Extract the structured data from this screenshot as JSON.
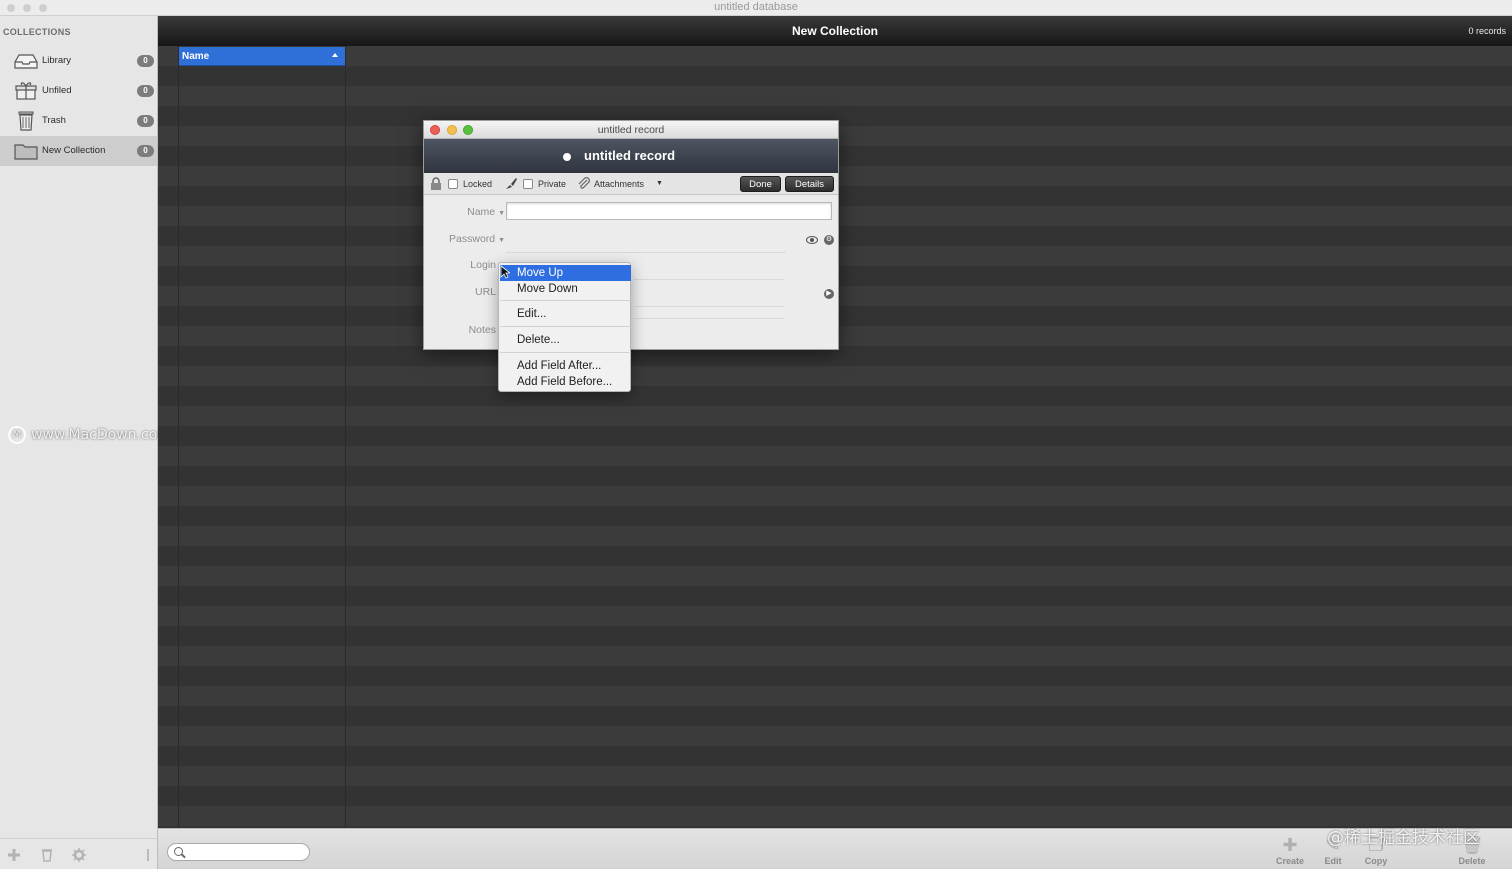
{
  "window": {
    "title": "untitled database"
  },
  "sidebar": {
    "header": "COLLECTIONS",
    "items": [
      {
        "label": "Library",
        "count": "0",
        "icon": "inbox-tray-icon"
      },
      {
        "label": "Unfiled",
        "count": "0",
        "icon": "gift-box-icon"
      },
      {
        "label": "Trash",
        "count": "0",
        "icon": "trash-icon"
      },
      {
        "label": "New Collection",
        "count": "0",
        "icon": "folder-icon",
        "selected": true
      }
    ],
    "watermark": "www.MacDown.com"
  },
  "main": {
    "title": "New Collection",
    "record_count": "0 records",
    "column_header": "Name"
  },
  "toolbar": {
    "search_placeholder": "",
    "buttons": [
      {
        "label": "Create",
        "icon": "plus-icon"
      },
      {
        "label": "Edit",
        "icon": "pencil-icon"
      },
      {
        "label": "Copy",
        "icon": "copy-icon"
      },
      {
        "label": "Delete",
        "icon": "trash-icon"
      }
    ],
    "watermark": "@稀土掘金技术社区"
  },
  "record": {
    "window_title": "untitled record",
    "heading": "untitled record",
    "locked_label": "Locked",
    "private_label": "Private",
    "attachments_label": "Attachments",
    "done_label": "Done",
    "details_label": "Details",
    "fields": {
      "name": "Name",
      "password": "Password",
      "login": "Login",
      "url": "URL",
      "notes": "Notes"
    },
    "name_value": ""
  },
  "context_menu": {
    "items": [
      "Move Up",
      "Move Down",
      "Edit...",
      "Delete...",
      "Add Field After...",
      "Add Field Before..."
    ],
    "highlighted": "Move Up"
  },
  "colors": {
    "selection_blue": "#2f6ee0",
    "close_red": "#ec5f56",
    "minimize_yellow": "#f4bf4f",
    "zoom_green": "#5ac13f"
  }
}
